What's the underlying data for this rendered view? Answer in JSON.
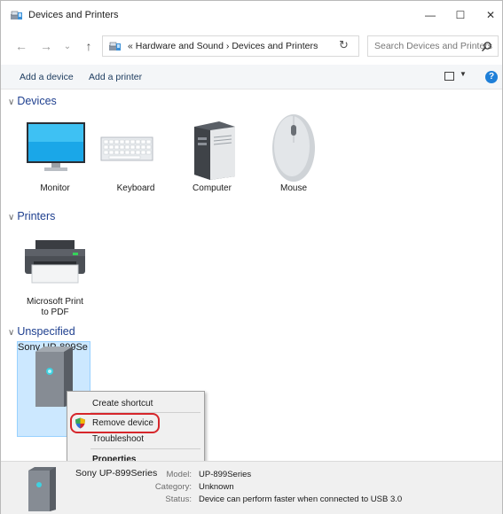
{
  "window": {
    "title": "Devices and Printers",
    "controls": {
      "minimize": "—",
      "maximize": "☐",
      "close": "✕"
    }
  },
  "navigation": {
    "address_path": "« Hardware and Sound  ›  Devices and Printers",
    "search_placeholder": "Search Devices and Printers"
  },
  "toolbar": {
    "add_device": "Add a device",
    "add_printer": "Add a printer"
  },
  "groups": {
    "devices": {
      "header": "Devices",
      "items": [
        {
          "label": "Monitor",
          "icon": "monitor-icon"
        },
        {
          "label": "Keyboard",
          "icon": "keyboard-icon"
        },
        {
          "label": "Computer",
          "icon": "computer-icon"
        },
        {
          "label": "Mouse",
          "icon": "mouse-icon"
        }
      ]
    },
    "printers": {
      "header": "Printers",
      "items": [
        {
          "label_line1": "Microsoft Print",
          "label_line2": "to PDF",
          "icon": "printer-icon"
        }
      ]
    },
    "unspecified": {
      "header": "Unspecified",
      "items": [
        {
          "label_line1": "Sony",
          "label_line2": "UP-899Se",
          "icon": "server-device-icon",
          "selected": true
        }
      ]
    }
  },
  "context_menu": {
    "items": [
      "Create shortcut",
      "Remove device",
      "Troubleshoot",
      "Properties"
    ],
    "highlighted": "Remove device",
    "highlight_color": "#d6262b"
  },
  "details": {
    "device_name": "Sony UP-899Series",
    "model_label": "Model:",
    "model_value": "UP-899Series",
    "category_label": "Category:",
    "category_value": "Unknown",
    "status_label": "Status:",
    "status_value": "Device can perform faster when connected to USB 3.0"
  },
  "colors": {
    "group_header": "#1e3f8f",
    "selection_bg": "#cce8ff",
    "selection_border": "#99d1ff",
    "help": "#1e7fd8"
  }
}
